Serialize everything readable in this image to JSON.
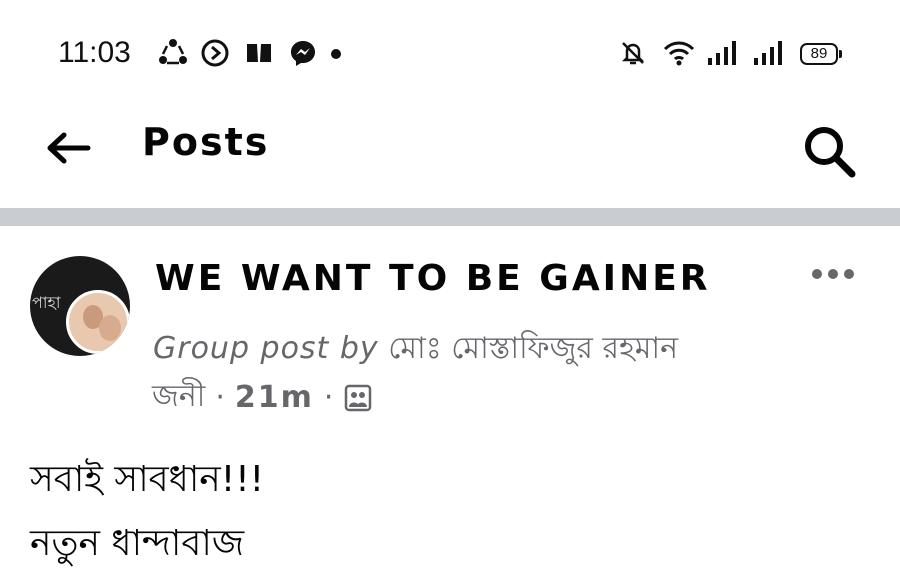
{
  "status_bar": {
    "time": "11:03",
    "battery": "89",
    "left_icons": [
      "share-icon",
      "play-circle-icon",
      "book-icon",
      "messenger-icon"
    ],
    "right_icons": [
      "bell-off-icon",
      "wifi-icon",
      "signal-icon",
      "signal-icon"
    ]
  },
  "app_bar": {
    "title": "Posts"
  },
  "post": {
    "group_name": "WE WANT TO BE GAINER",
    "group_post_by_label": "Group post by",
    "author_name": "মোঃ মোস্তাফিজুর রহমান",
    "author_name_cont": "জনী",
    "separator": "·",
    "time_ago": "21m",
    "audience_icon": "group-photo-icon",
    "avatar_text": "পাহা",
    "lines": [
      "সবাই সাবধান!!!",
      "নতুন ধান্দাবাজ"
    ]
  },
  "colors": {
    "divider": "#c9ccd1",
    "meta": "#65676b",
    "text": "#050505"
  }
}
